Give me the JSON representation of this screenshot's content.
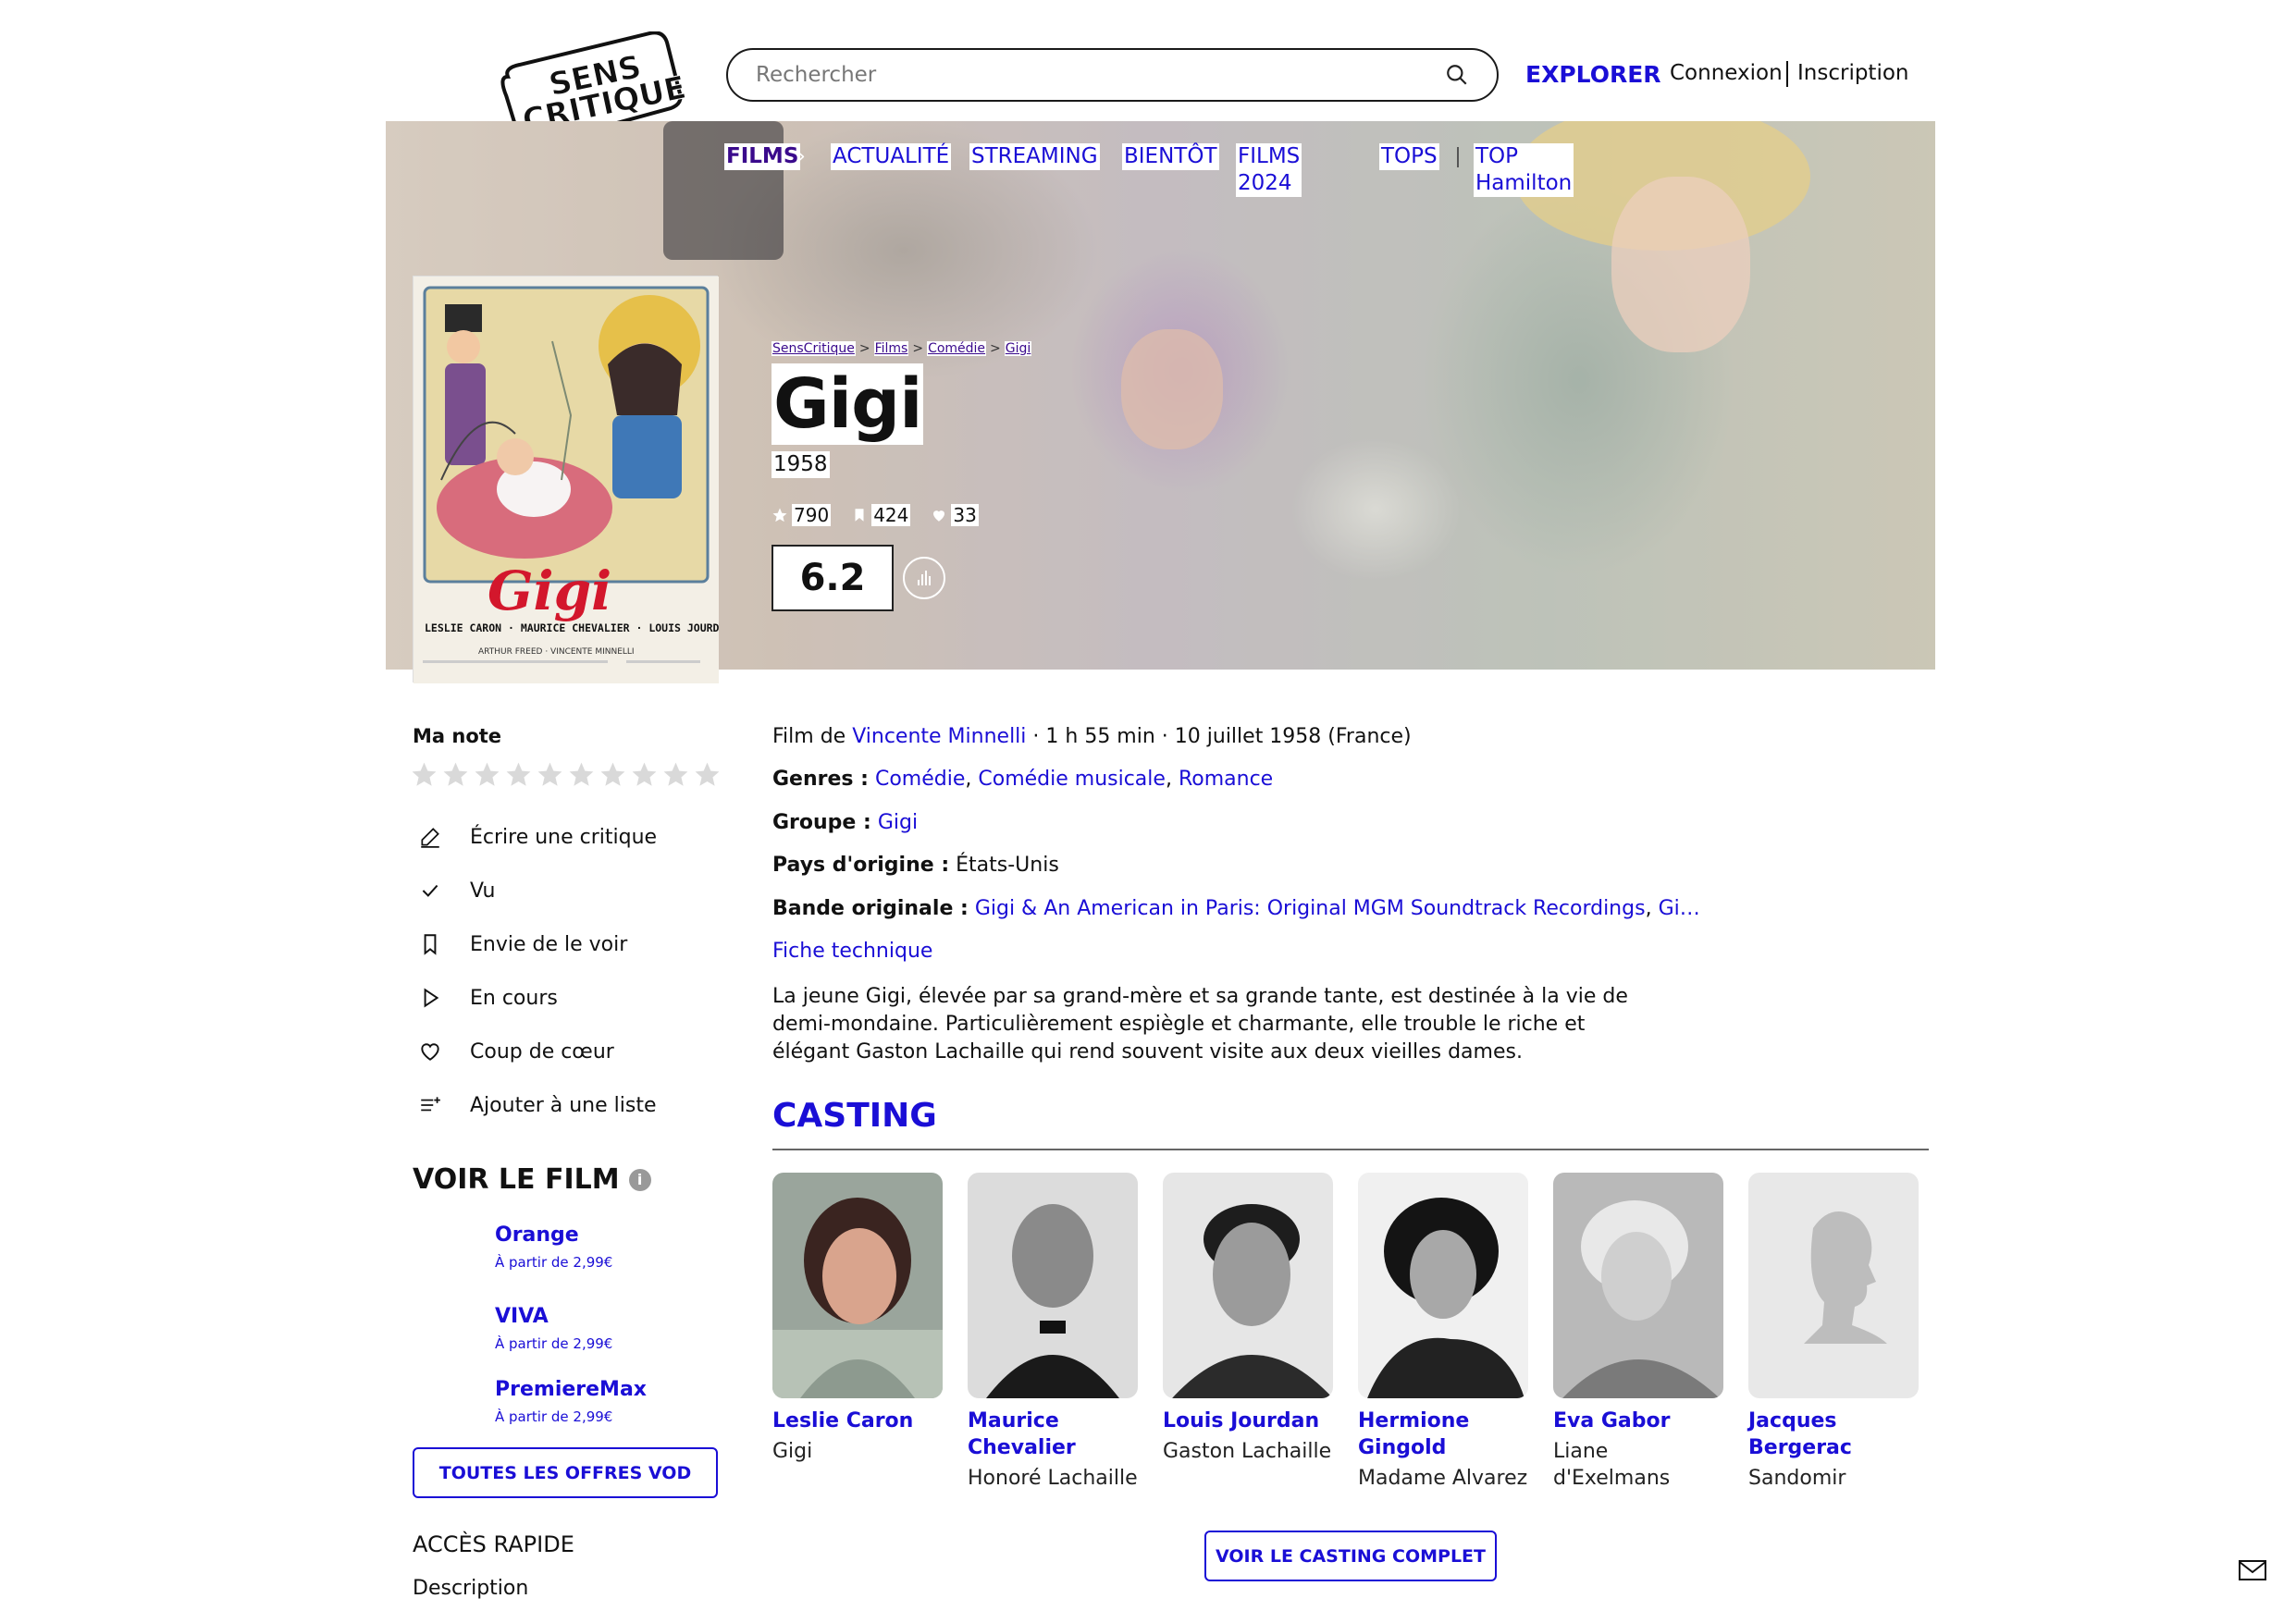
{
  "header": {
    "logo_text": "SENS CRITIQUE",
    "search_placeholder": "Rechercher",
    "explorer": "EXPLORER",
    "login": "Connexion",
    "signup": "Inscription"
  },
  "nav": {
    "films": "FILMS",
    "actualite": "ACTUALITÉ",
    "streaming": "STREAMING",
    "bientot": "BIENTÔT",
    "films2024": "FILMS 2024",
    "tops": "TOPS",
    "top_hamilton": "TOP Hamilton"
  },
  "poster": {
    "title_art": "Gigi",
    "cast_line": "LESLIE CARON · MAURICE CHEVALIER · LOUIS JOURDAN",
    "credit_line": "ARTHUR FREED · VINCENTE MINNELLI"
  },
  "breadcrumb": [
    "SensCritique",
    "Films",
    "Comédie",
    "Gigi"
  ],
  "film": {
    "title": "Gigi",
    "year": "1958",
    "ratings_count": "790",
    "wishlist_count": "424",
    "favorites_count": "33",
    "score": "6.2",
    "director_prefix": "Film de",
    "director": "Vincente Minnelli",
    "details": "· 1 h 55 min · 10 juillet 1958 (France)",
    "genres_label": "Genres :",
    "genres": [
      "Comédie",
      "Comédie musicale",
      "Romance"
    ],
    "group_label": "Groupe :",
    "group": "Gigi",
    "country_label": "Pays d'origine :",
    "country": "États-Unis",
    "soundtrack_label": "Bande originale :",
    "soundtrack": "Gigi & An American in Paris: Original MGM Soundtrack Recordings",
    "soundtrack_more": "Gi…",
    "fiche": "Fiche technique",
    "synopsis": "La jeune Gigi, élevée par sa grand-mère et sa grande tante, est destinée à la vie de demi-mondaine. Particulièrement espiègle et charmante, elle trouble le riche et élégant Gaston Lachaille qui rend souvent visite aux deux vieilles dames."
  },
  "sidebar": {
    "ma_note": "Ma note",
    "actions": [
      "Écrire une critique",
      "Vu",
      "Envie de le voir",
      "En cours",
      "Coup de cœur",
      "Ajouter à une liste"
    ],
    "voir_le_film": "VOIR LE FILM",
    "info_glyph": "i",
    "vod": [
      {
        "name": "Orange",
        "price": "À partir de 2,99€"
      },
      {
        "name": "VIVA",
        "price": "À partir de 2,99€"
      },
      {
        "name": "PremiereMax",
        "price": "À partir de 2,99€"
      }
    ],
    "offers_button": "TOUTES LES OFFRES VOD",
    "acces_rapide": "ACCÈS RAPIDE",
    "description": "Description"
  },
  "casting": {
    "title": "CASTING",
    "actors": [
      {
        "name": "Leslie Caron",
        "role": "Gigi"
      },
      {
        "name": "Maurice Chevalier",
        "role": "Honoré Lachaille"
      },
      {
        "name": "Louis Jourdan",
        "role": "Gaston Lachaille"
      },
      {
        "name": "Hermione Gingold",
        "role": "Madame Alvarez"
      },
      {
        "name": "Eva Gabor",
        "role": "Liane d'Exelmans"
      },
      {
        "name": "Jacques Bergerac",
        "role": "Sandomir"
      }
    ],
    "full_button": "VOIR LE CASTING COMPLET"
  },
  "colors": {
    "link": "#1a0ed6",
    "films_nav": "#3a0a8c",
    "text": "#111111"
  }
}
